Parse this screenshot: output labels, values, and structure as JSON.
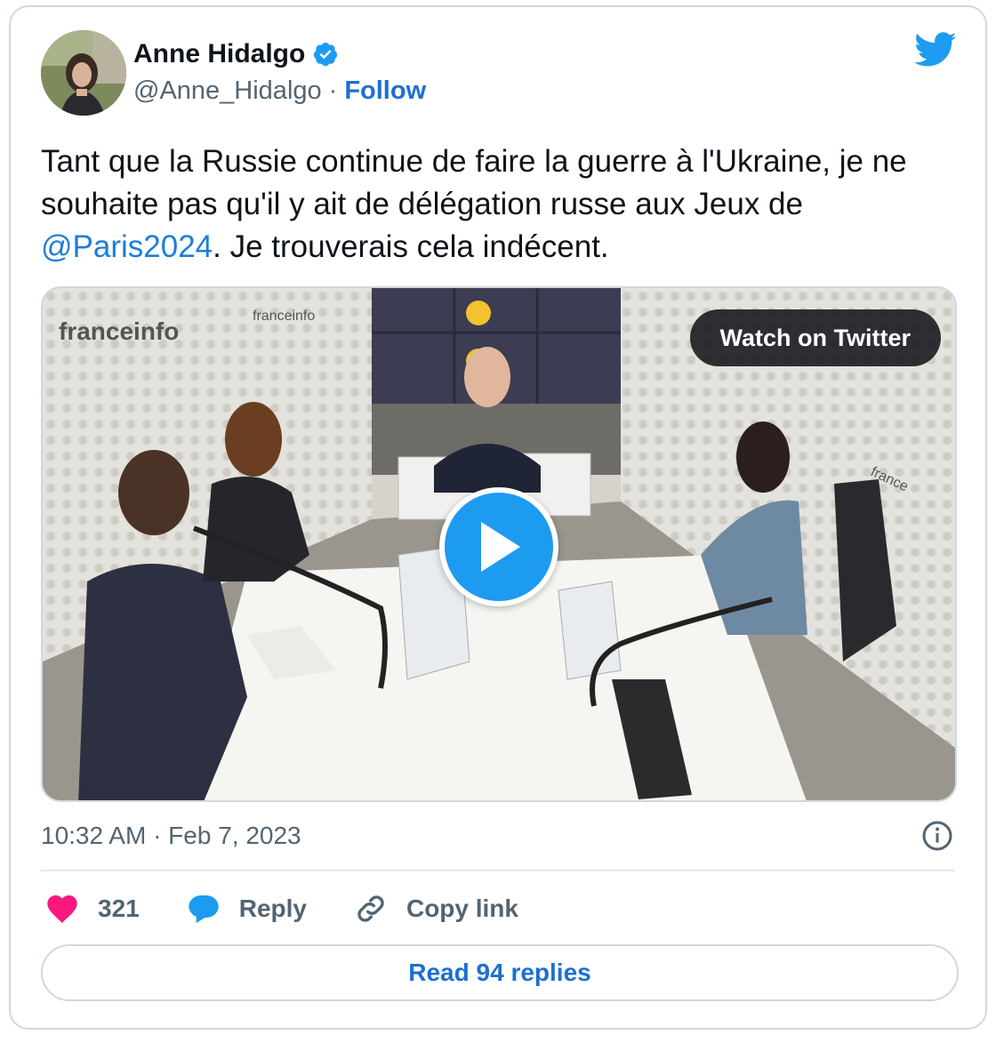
{
  "author": {
    "name": "Anne Hidalgo",
    "handle": "@Anne_Hidalgo",
    "separator": "·",
    "follow_label": "Follow"
  },
  "tweet": {
    "text_before_mention": "Tant que la Russie continue de faire la guerre à l'Ukraine, je ne souhaite pas qu'il y ait de délégation russe aux Jeux de ",
    "mention": "@Paris2024",
    "text_after_mention": ". Je trouverais cela indécent."
  },
  "media": {
    "watch_label": "Watch on Twitter",
    "studio_brand": "franceinfo",
    "studio_brand_alt": "france"
  },
  "meta": {
    "timestamp": "10:32 AM · Feb 7, 2023"
  },
  "actions": {
    "like_count": "321",
    "reply_label": "Reply",
    "copy_link_label": "Copy link"
  },
  "read_replies_label": "Read 94 replies",
  "colors": {
    "brand_blue": "#1d9bf0",
    "link_blue": "#1d6fd1",
    "heart": "#f91880",
    "reply_bubble": "#1d9bf0"
  },
  "icons": [
    "verified-badge-icon",
    "twitter-bird-icon",
    "play-icon",
    "info-icon",
    "heart-icon",
    "reply-icon",
    "link-icon"
  ]
}
